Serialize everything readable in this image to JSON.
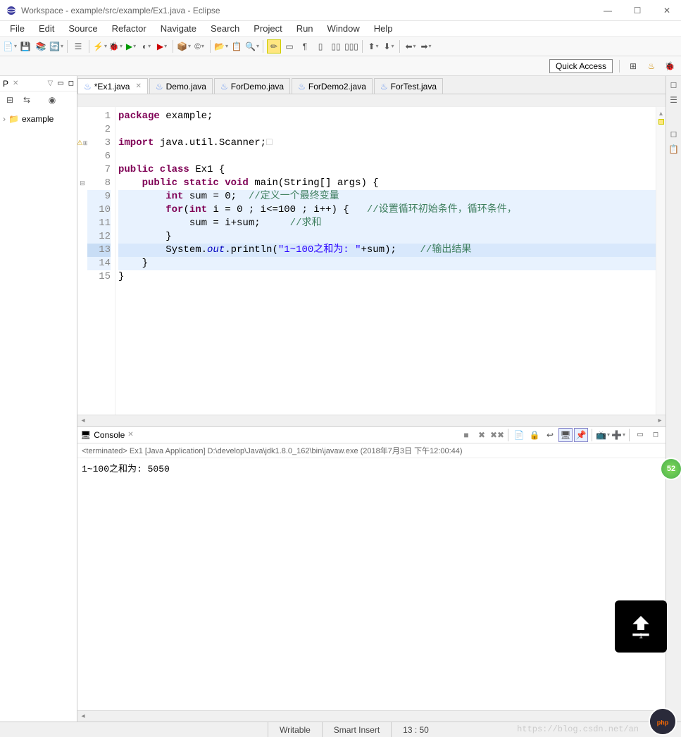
{
  "window": {
    "title": "Workspace - example/src/example/Ex1.java - Eclipse"
  },
  "menu": [
    "File",
    "Edit",
    "Source",
    "Refactor",
    "Navigate",
    "Search",
    "Project",
    "Run",
    "Window",
    "Help"
  ],
  "quick_access": "Quick Access",
  "project_explorer": {
    "tab": "P",
    "root": "example"
  },
  "editor_tabs": [
    {
      "label": "*Ex1.java",
      "active": true,
      "dirty": true
    },
    {
      "label": "Demo.java",
      "active": false
    },
    {
      "label": "ForDemo.java",
      "active": false
    },
    {
      "label": "ForDemo2.java",
      "active": false
    },
    {
      "label": "ForTest.java",
      "active": false
    }
  ],
  "code": {
    "lines": [
      {
        "n": 1,
        "tokens": [
          [
            "kw",
            "package"
          ],
          [
            "",
            " example;"
          ]
        ]
      },
      {
        "n": 2,
        "tokens": []
      },
      {
        "n": 3,
        "marker": "warn",
        "fold": "+",
        "tokens": [
          [
            "kw",
            "import"
          ],
          [
            "",
            " java.util.Scanner;"
          ]
        ],
        "tail": "□"
      },
      {
        "n": 6,
        "tokens": []
      },
      {
        "n": 7,
        "tokens": [
          [
            "kw",
            "public class"
          ],
          [
            "",
            " Ex1 {"
          ]
        ]
      },
      {
        "n": 8,
        "fold": "-",
        "tokens": [
          [
            "",
            "    "
          ],
          [
            "kw",
            "public static void"
          ],
          [
            "",
            " main(String[] args) {"
          ]
        ]
      },
      {
        "n": 9,
        "hl": true,
        "tokens": [
          [
            "",
            "        "
          ],
          [
            "kw",
            "int"
          ],
          [
            "",
            " sum = 0;  "
          ],
          [
            "cmt",
            "//定义一个最终变量"
          ]
        ]
      },
      {
        "n": 10,
        "hl": true,
        "tokens": [
          [
            "",
            "        "
          ],
          [
            "kw",
            "for"
          ],
          [
            "",
            "("
          ],
          [
            "kw",
            "int"
          ],
          [
            "",
            " i = 0 ; i<=100 ; i++) {   "
          ],
          [
            "cmt",
            "//设置循环初始条件，循环条件，"
          ]
        ]
      },
      {
        "n": 11,
        "hl": true,
        "tokens": [
          [
            "",
            "            sum = i+sum;     "
          ],
          [
            "cmt",
            "//求和"
          ]
        ]
      },
      {
        "n": 12,
        "hl": true,
        "tokens": [
          [
            "",
            "        }"
          ]
        ]
      },
      {
        "n": 13,
        "hl": true,
        "cur": true,
        "tokens": [
          [
            "",
            "        System."
          ],
          [
            "fld",
            "out"
          ],
          [
            "",
            ".println("
          ],
          [
            "str",
            "\"1~100之和为: \""
          ],
          [
            "",
            "+sum);    "
          ],
          [
            "cmt",
            "//输出结果"
          ]
        ]
      },
      {
        "n": 14,
        "hl": true,
        "tokens": [
          [
            "",
            "    }"
          ]
        ]
      },
      {
        "n": 15,
        "tokens": [
          [
            "",
            "}"
          ]
        ]
      }
    ]
  },
  "console": {
    "tab": "Console",
    "header": "<terminated> Ex1 [Java Application] D:\\develop\\Java\\jdk1.8.0_162\\bin\\javaw.exe (2018年7月3日 下午12:00:44)",
    "output": "1~100之和为: 5050"
  },
  "status": {
    "writable": "Writable",
    "insert": "Smart Insert",
    "pos": "13 : 50"
  },
  "watermark": "https://blog.csdn.net/an",
  "php_badge": "php中文网",
  "badge52": "52"
}
